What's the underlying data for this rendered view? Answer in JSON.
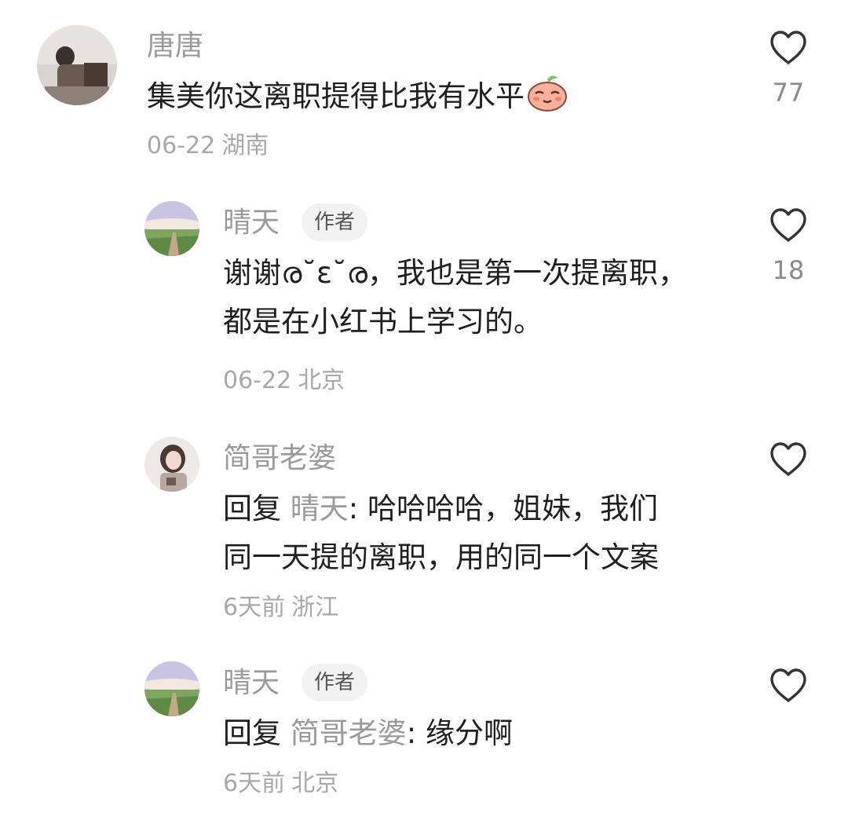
{
  "comments": [
    {
      "username": "唐唐",
      "text": "集美你这离职提得比我有水平",
      "emoji": "blushing-peach-emoji",
      "date": "06-22",
      "location": "湖南",
      "likes": "77"
    },
    {
      "username": "晴天",
      "badge": "作者",
      "line1": "谢谢ര˘ε˘ര，我也是第一次提离职，",
      "line2": "都是在小红书上学习的。",
      "date": "06-22",
      "location": "北京",
      "likes": "18"
    },
    {
      "username": "简哥老婆",
      "reply_prefix": "回复",
      "reply_target": "晴天",
      "line1": ": 哈哈哈哈，姐妹，我们",
      "line2": "同一天提的离职，用的同一个文案",
      "date": "6天前",
      "location": "浙江",
      "likes": ""
    },
    {
      "username": "晴天",
      "badge": "作者",
      "reply_prefix": "回复",
      "reply_target": "简哥老婆",
      "line1": ": 缘分啊",
      "date": "6天前",
      "location": "北京",
      "likes": ""
    }
  ],
  "icons": {
    "like": "heart-outline-icon"
  }
}
